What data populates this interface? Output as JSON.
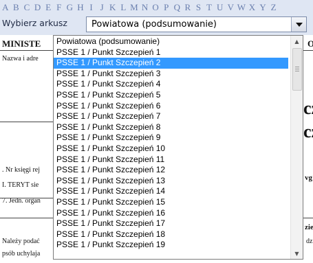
{
  "column_letters": [
    "A",
    "B",
    "C",
    "D",
    "E",
    "F",
    "G",
    "H",
    "I",
    "J",
    "K",
    "L",
    "M",
    "N",
    "O",
    "P",
    "Q",
    "R",
    "S",
    "T",
    "U",
    "V",
    "W",
    "X",
    "Y",
    "Z"
  ],
  "sheet_selector": {
    "label": "Wybierz arkusz",
    "value": "Powiatowa (podsumowanie)"
  },
  "document": {
    "header_left": "MINISTE",
    "header_right": "O",
    "name_label": "Nazwa i adre",
    "big_char_1": "cz",
    "big_char_2": "cz",
    "ksiegi": ". Nr księgi rej",
    "teryt": "I. TERYT sie",
    "jedn": "7. Jedn. organ",
    "vg": "vg",
    "zie": "zie",
    "nalezy": "Należy podać",
    "dz": "dz",
    "sposob": "psób uchylaja"
  },
  "dropdown": {
    "selected_index": 2,
    "options": [
      "Powiatowa (podsumowanie)",
      "PSSE 1 / Punkt Szczepień 1",
      "PSSE 1 / Punkt Szczepień 2",
      "PSSE 1 / Punkt Szczepień 3",
      "PSSE 1 / Punkt Szczepień 4",
      "PSSE 1 / Punkt Szczepień 5",
      "PSSE 1 / Punkt Szczepień 6",
      "PSSE 1 / Punkt Szczepień 7",
      "PSSE 1 / Punkt Szczepień 8",
      "PSSE 1 / Punkt Szczepień 9",
      "PSSE 1 / Punkt Szczepień 10",
      "PSSE 1 / Punkt Szczepień 11",
      "PSSE 1 / Punkt Szczepień 12",
      "PSSE 1 / Punkt Szczepień 13",
      "PSSE 1 / Punkt Szczepień 14",
      "PSSE 1 / Punkt Szczepień 15",
      "PSSE 1 / Punkt Szczepień 16",
      "PSSE 1 / Punkt Szczepień 17",
      "PSSE 1 / Punkt Szczepień 18",
      "PSSE 1 / Punkt Szczepień 19"
    ]
  },
  "colors": {
    "toolbar_bg": "#dfe6f3",
    "selection": "#3399ff"
  },
  "icons": {
    "select_arrow": "chevron-down-icon",
    "scroll_up": "scroll-up-icon",
    "scroll_down": "scroll-down-icon"
  }
}
